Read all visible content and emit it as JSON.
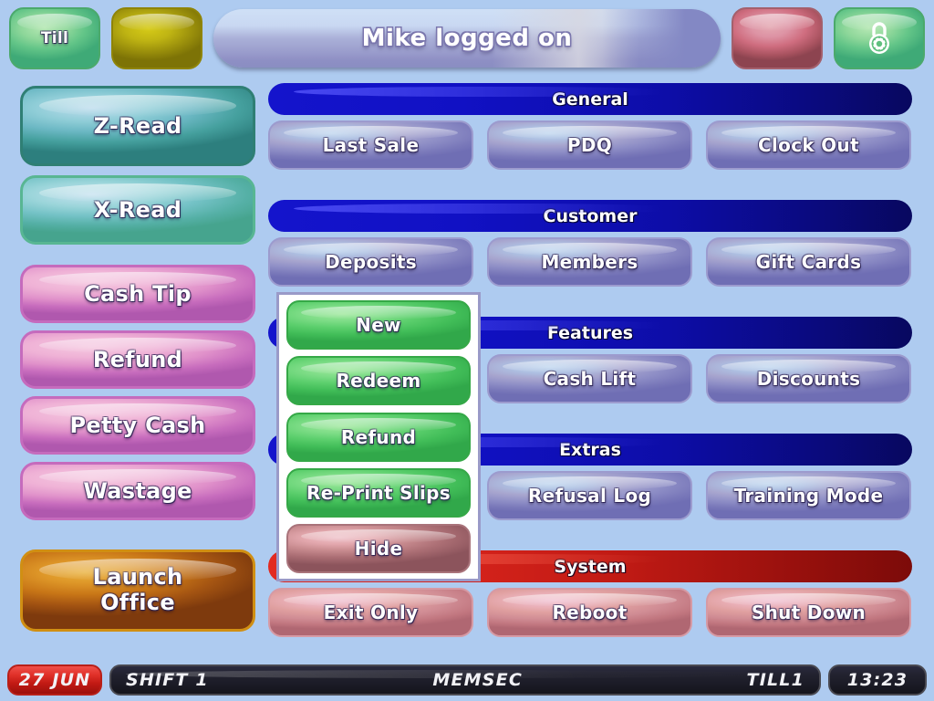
{
  "topbar": {
    "till_label": "Till",
    "blank_label": "",
    "title": "Mike logged on",
    "alert_label": "",
    "lock_icon": "padlock-icon"
  },
  "sidebar": {
    "items": [
      {
        "label": "Z-Read",
        "name": "z-read"
      },
      {
        "label": "X-Read",
        "name": "x-read"
      },
      {
        "label": "Cash Tip",
        "name": "cash-tip"
      },
      {
        "label": "Refund",
        "name": "refund"
      },
      {
        "label": "Petty Cash",
        "name": "petty-cash"
      },
      {
        "label": "Wastage",
        "name": "wastage"
      },
      {
        "label": "Launch",
        "label2": "Office",
        "name": "launch-office"
      }
    ]
  },
  "main": {
    "sections": [
      {
        "header": "General",
        "buttons": [
          "Last Sale",
          "PDQ",
          "Clock Out"
        ]
      },
      {
        "header": "Customer",
        "buttons": [
          "Deposits",
          "Members",
          "Gift Cards"
        ]
      },
      {
        "header": "Features",
        "buttons": [
          "Cash Lift",
          "Discounts"
        ]
      },
      {
        "header": "Extras",
        "buttons": [
          "Refusal Log",
          "Training Mode"
        ]
      },
      {
        "header": "System",
        "buttons": [
          "Exit Only",
          "Reboot",
          "Shut Down"
        ]
      }
    ]
  },
  "popup": {
    "items": [
      "New",
      "Redeem",
      "Refund",
      "Re-Print Slips",
      "Hide"
    ]
  },
  "status": {
    "date": "27 JUN",
    "shift": "SHIFT 1",
    "operator": "MEMSEC",
    "till": "TILL1",
    "time": "13:23"
  },
  "colors": {
    "background": "#aecbf0",
    "header_blue": "#1111c4",
    "header_red": "#d8241c",
    "button_purple": "#8e8ec6",
    "button_rose": "#d08c94",
    "popup_green": "#5ccf6d",
    "status_red": "#e03028",
    "status_dark": "#22222f"
  }
}
